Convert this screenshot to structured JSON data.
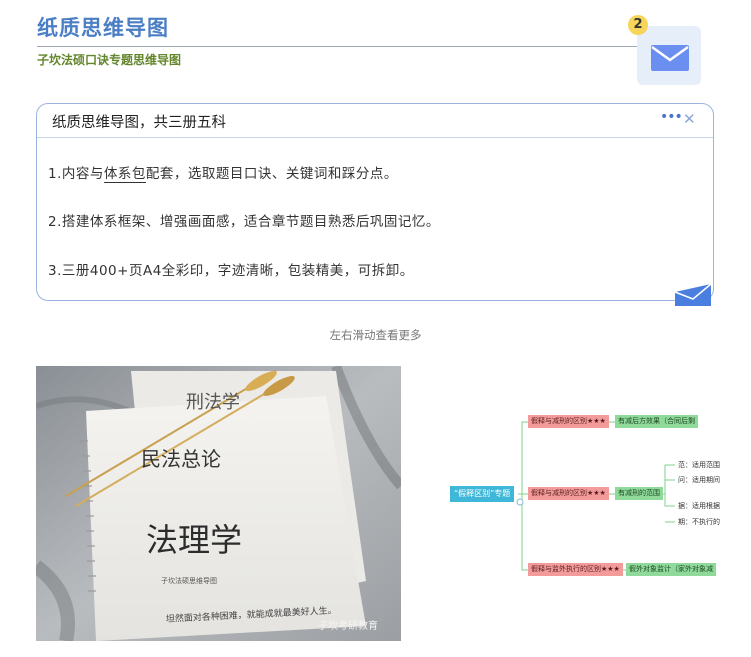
{
  "header": {
    "title": "纸质思维导图",
    "subtitle": "子坎法硕口诀专题思维导图",
    "badge_count": "2",
    "mail_icon": "mail-icon"
  },
  "card": {
    "title": "纸质思维导图，共三册五科",
    "line1_pre": "1.内容与",
    "line1_ul": "体系包",
    "line1_post": "配套，选取题目口诀、关键词和踩分点。",
    "line2": "2.搭建体系框架、增强画面感，适合章节题目熟悉后巩固记忆。",
    "line3": "3.三册400+页A4全彩印，字迹清晰，包装精美，可拆卸。",
    "dots": "•••",
    "close": "✕"
  },
  "swipe_hint": "左右滑动查看更多",
  "photo": {
    "text1": "刑法学",
    "text2": "民法总论",
    "text3": "法理学",
    "text4": "子坎法硕思维导图",
    "text5": "坦然面对各种困难，就能成就最美好人生。",
    "watermark": "子坎考研教育"
  },
  "mindmap": {
    "root": "“假释区别”专题",
    "branch1": "假释与减刑的区别★★★",
    "branch1_leaf": "有减后方效果（合同后剩",
    "branch2": "假释与减刑的区别★★★",
    "branch2_leaf": "有减刑的范围",
    "branch3": "假释与监外执行的区别★★★",
    "branch3_leaf": "假外对象监计（家外对象减",
    "sub1": "范：适用范围",
    "sub2": "问：适用期间",
    "sub3": "据：适用根据",
    "sub4": "期：不执行的"
  }
}
